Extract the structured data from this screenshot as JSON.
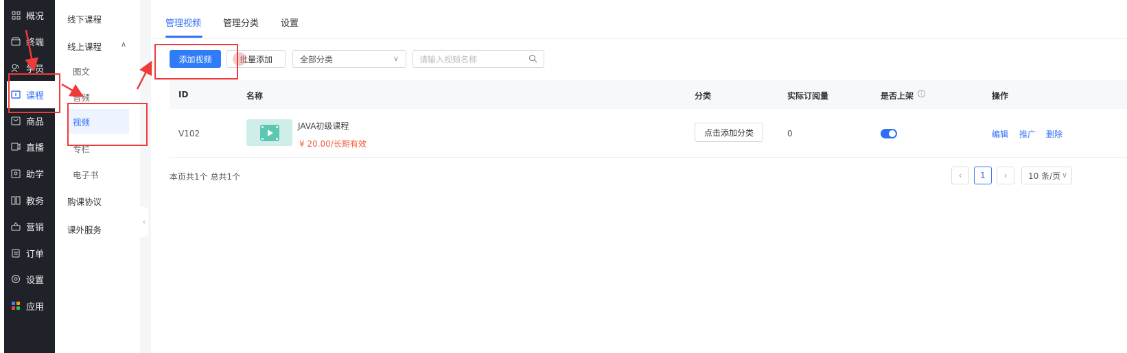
{
  "left_nav": {
    "items": [
      {
        "label": "概况",
        "icon": "grid-icon"
      },
      {
        "label": "终端",
        "icon": "store-icon"
      },
      {
        "label": "学员",
        "icon": "users-icon"
      },
      {
        "label": "课程",
        "icon": "course-icon"
      },
      {
        "label": "商品",
        "icon": "goods-icon"
      },
      {
        "label": "直播",
        "icon": "live-icon"
      },
      {
        "label": "助学",
        "icon": "assist-icon"
      },
      {
        "label": "教务",
        "icon": "edu-icon"
      },
      {
        "label": "营销",
        "icon": "marketing-icon"
      },
      {
        "label": "订单",
        "icon": "order-icon"
      },
      {
        "label": "设置",
        "icon": "settings-icon"
      },
      {
        "label": "应用",
        "icon": "apps-icon"
      }
    ]
  },
  "sub_nav": {
    "offline": "线下课程",
    "online": "线上课程",
    "children": [
      "图文",
      "音频",
      "视频",
      "专栏",
      "电子书"
    ],
    "agreement": "购课协议",
    "extra": "课外服务"
  },
  "tabs": [
    "管理视频",
    "管理分类",
    "设置"
  ],
  "toolbar": {
    "add_label": "添加视频",
    "batch_label": "批量添加",
    "category_select": "全部分类",
    "search_placeholder": "请输入视频名称"
  },
  "table": {
    "headers": [
      "ID",
      "名称",
      "分类",
      "实际订阅量",
      "是否上架",
      "操作"
    ],
    "rows": [
      {
        "id": "V102",
        "title": "JAVA初级课程",
        "price": "¥ 20.00/长期有效",
        "category_btn": "点击添加分类",
        "subs": "0",
        "listed": true,
        "ops": [
          "编辑",
          "推广",
          "删除"
        ]
      }
    ]
  },
  "pagination": {
    "summary": "本页共1个 总共1个",
    "current": "1",
    "page_size": "10 条/页"
  },
  "colors": {
    "primary": "#2f7cf6",
    "nav_bg": "#1f2329",
    "annotation": "#f03a3a",
    "price": "#f05a3a"
  }
}
